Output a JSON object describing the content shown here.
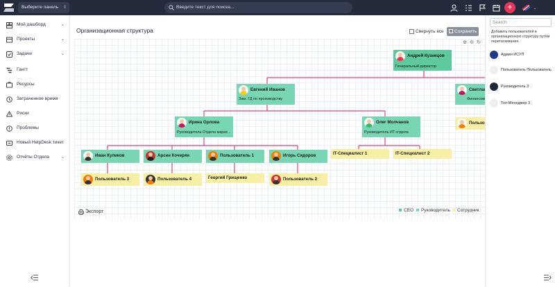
{
  "topbar": {
    "panel_label": "Выберите панель",
    "search_placeholder": "Введите текст для поиска...",
    "plus": "+"
  },
  "sidebar": {
    "items": [
      {
        "label": "Мой дашборд",
        "chev": "⌄"
      },
      {
        "label": "Проекты",
        "chev": "⌄"
      },
      {
        "label": "Задачи",
        "chev": "⌄"
      },
      {
        "label": "Гантт"
      },
      {
        "label": "Ресурсы"
      },
      {
        "label": "Затраченное время"
      },
      {
        "label": "Риски"
      },
      {
        "label": "Проблемы"
      },
      {
        "label": "Новый HelpDesk тикет"
      },
      {
        "label": "Отчёты Отдела",
        "chev": "⌄"
      }
    ]
  },
  "main": {
    "title": "Организационная структура",
    "collapse_all": "Свернуть все",
    "save": "Сохранить",
    "export": "Экспорт"
  },
  "org": {
    "ceo": {
      "name": "Андрей Кузнецов",
      "title": "Генеральный директор"
    },
    "deputy": {
      "name": "Евгений Иванов",
      "title": "Зам. ГД по производству"
    },
    "fin": {
      "name": "Светлана",
      "title": "Финансовый"
    },
    "user_right": {
      "name": "Пользователь"
    },
    "orlova": {
      "name": "Ирина Орлова",
      "title": "Руководитель Отдела марке..."
    },
    "molchanov": {
      "name": "Олег Молчанов",
      "title": "Руководитель ИТ-отдела"
    },
    "kulikov": {
      "name": "Иван Куликов"
    },
    "kocheryan": {
      "name": "Арсен Кочерян"
    },
    "user1": {
      "name": "Пользователь 1"
    },
    "sidorov": {
      "name": "Игорь Сидоров"
    },
    "it1": {
      "name": "IT-Специалист 1"
    },
    "it2": {
      "name": "IT-Специалист 2"
    },
    "user3": {
      "name": "Пользователь 3"
    },
    "user4": {
      "name": "Пользователь 4"
    },
    "grishchenko": {
      "name": "Георгий Грищенко"
    },
    "user2": {
      "name": "Пользователь 2"
    }
  },
  "legend": [
    {
      "label": "CEO",
      "color": "#5ec99c"
    },
    {
      "label": "Руководитель",
      "color": "#77d7b4"
    },
    {
      "label": "Сотрудник",
      "color": "#f7f0a4"
    }
  ],
  "right": {
    "search_placeholder": "Search",
    "hint": "Добавить пользователей в организационную структуру путём перетаскивания.",
    "users": [
      {
        "label": "Админ ИСУП"
      },
      {
        "label": "Пользователь Пользователь"
      },
      {
        "label": "Руководитель 3"
      },
      {
        "label": "Топ-Менеджер 3"
      }
    ]
  },
  "colors": {
    "topbar": "#252b3d",
    "accent": "#e8335a",
    "connector": "#e0457a"
  }
}
